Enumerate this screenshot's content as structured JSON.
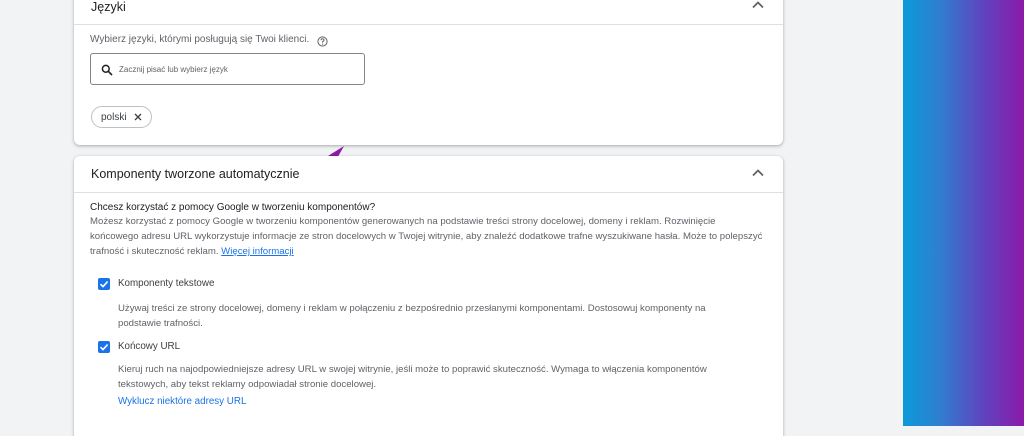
{
  "languages_card": {
    "title": "Języki",
    "hint": "Wybierz języki, którymi posługują się Twoi klienci.",
    "search_placeholder": "Zacznij pisać lub wybierz język",
    "chips": [
      {
        "label": "polski"
      }
    ]
  },
  "auto_assets_card": {
    "title": "Komponenty tworzone automatycznie",
    "question": "Chcesz korzystać z pomocy Google w tworzeniu komponentów?",
    "description": "Możesz korzystać z pomocy Google w tworzeniu komponentów generowanych na podstawie treści strony docelowej, domeny i reklam. Rozwinięcie końcowego adresu URL wykorzystuje informacje ze stron docelowych w Twojej witrynie, aby znaleźć dodatkowe trafne wyszukiwane hasła. Może to polepszyć trafność i skuteczność reklam.",
    "more_info_link": "Więcej informacji",
    "options": [
      {
        "label": "Komponenty tekstowe",
        "checked": true,
        "description": "Używaj treści ze strony docelowej, domeny i reklam w połączeniu z bezpośrednio przesłanymi komponentami. Dostosowuj komponenty na podstawie trafności."
      },
      {
        "label": "Końcowy URL",
        "checked": true,
        "description": "Kieruj ruch na najodpowiedniejsze adresy URL w swojej witrynie, jeśli może to poprawić skuteczność. Wymaga to włączenia komponentów tekstowych, aby tekst reklamy odpowiadał stronie docelowej."
      }
    ],
    "exclude_link": "Wyklucz niektóre adresy URL"
  },
  "colors": {
    "accent": "#1a73e8",
    "pointer": "#8e1aa6",
    "background": "#f1f3f4"
  },
  "icons": [
    "chevron-up-icon",
    "help-icon",
    "search-icon",
    "close-icon",
    "checkmark-icon",
    "pointer-arrow-icon"
  ]
}
